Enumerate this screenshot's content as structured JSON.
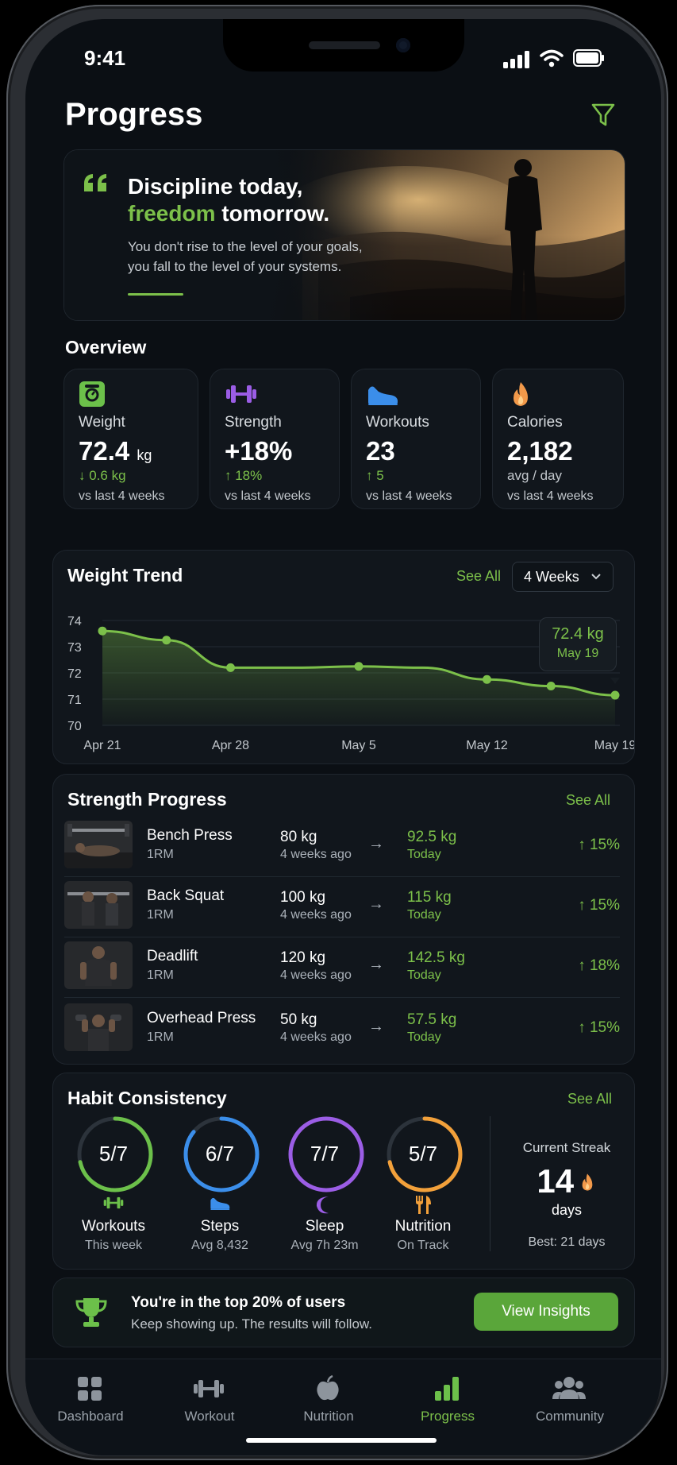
{
  "status": {
    "time": "9:41"
  },
  "header": {
    "title": "Progress",
    "filter_icon": "filter-icon"
  },
  "quote": {
    "line1": "Discipline today,",
    "line2_accent": "freedom",
    "line2_rest": " tomorrow.",
    "body1": "You don't rise to the level of your goals,",
    "body2": "you fall to the level of your systems.",
    "quote_icon": "quote-icon"
  },
  "overview": {
    "title": "Overview",
    "cards": [
      {
        "label": "Weight",
        "value": "72.4",
        "unit": "kg",
        "change": "↓ 0.6 kg",
        "vs": "vs last 4 weeks",
        "icon": "scale-icon",
        "color": "#6cc04a"
      },
      {
        "label": "Strength",
        "value": "+18%",
        "unit": "",
        "change": "↑ 18%",
        "vs": "vs last 4 weeks",
        "icon": "dumbbell-icon",
        "color": "#9b5de5"
      },
      {
        "label": "Workouts",
        "value": "23",
        "unit": "",
        "change": "↑ 5",
        "vs": "vs last 4 weeks",
        "icon": "shoe-icon",
        "color": "#3b8eea"
      },
      {
        "label": "Calories",
        "value": "2,182",
        "unit": "",
        "change": "avg / day",
        "vs": "vs last 4 weeks",
        "icon": "flame-icon",
        "color": "#f2994a"
      }
    ]
  },
  "weight_trend": {
    "title": "Weight Trend",
    "see_all": "See All",
    "range": "4 Weeks",
    "tooltip_value": "72.4 kg",
    "tooltip_date": "May 19"
  },
  "chart_data": {
    "type": "area",
    "x": [
      "Apr 21",
      "Apr 25",
      "Apr 28",
      "May 2",
      "May 5",
      "May 9",
      "May 12",
      "May 15",
      "May 19"
    ],
    "values": [
      73.6,
      73.25,
      72.2,
      72.2,
      72.25,
      72.2,
      71.75,
      71.5,
      71.15
    ],
    "point_markers": [
      0,
      1,
      2,
      4,
      6,
      7,
      8
    ],
    "xticks": [
      "Apr 21",
      "Apr 28",
      "May 5",
      "May 12",
      "May 19"
    ],
    "yticks": [
      "74",
      "73",
      "72",
      "71",
      "70"
    ],
    "ylim": [
      70,
      74
    ],
    "grid": true,
    "color": "#7cc04a"
  },
  "strength": {
    "title": "Strength Progress",
    "see_all": "See All",
    "rows": [
      {
        "name": "Bench Press",
        "sub": "1RM",
        "old": "80 kg",
        "old_sub": "4 weeks ago",
        "new": "92.5 kg",
        "new_sub": "Today",
        "pct": "↑ 15%"
      },
      {
        "name": "Back Squat",
        "sub": "1RM",
        "old": "100 kg",
        "old_sub": "4 weeks ago",
        "new": "115 kg",
        "new_sub": "Today",
        "pct": "↑ 15%"
      },
      {
        "name": "Deadlift",
        "sub": "1RM",
        "old": "120 kg",
        "old_sub": "4 weeks ago",
        "new": "142.5 kg",
        "new_sub": "Today",
        "pct": "↑ 18%"
      },
      {
        "name": "Overhead Press",
        "sub": "1RM",
        "old": "50 kg",
        "old_sub": "4 weeks ago",
        "new": "57.5 kg",
        "new_sub": "Today",
        "pct": "↑ 15%"
      }
    ]
  },
  "habits": {
    "title": "Habit Consistency",
    "see_all": "See All",
    "rings": [
      {
        "value": "5/7",
        "fraction": 0.714,
        "name": "Workouts",
        "sub": "This week",
        "color": "#6cc04a",
        "icon": "dumbbell-icon"
      },
      {
        "value": "6/7",
        "fraction": 0.857,
        "name": "Steps",
        "sub": "Avg 8,432",
        "color": "#3b8eea",
        "icon": "shoe-icon"
      },
      {
        "value": "7/7",
        "fraction": 1.0,
        "name": "Sleep",
        "sub": "Avg 7h 23m",
        "color": "#9b5de5",
        "icon": "moon-icon"
      },
      {
        "value": "5/7",
        "fraction": 0.714,
        "name": "Nutrition",
        "sub": "On Track",
        "color": "#f2a03a",
        "icon": "utensils-icon"
      }
    ],
    "streak_label": "Current Streak",
    "streak_value": "14",
    "streak_unit": "days",
    "best": "Best: 21 days"
  },
  "banner": {
    "title": "You're in the top 20% of users",
    "sub": "Keep showing up. The results will follow.",
    "button": "View Insights",
    "icon": "trophy-icon"
  },
  "nav": [
    {
      "label": "Dashboard",
      "icon": "dashboard-icon",
      "active": false
    },
    {
      "label": "Workout",
      "icon": "dumbbell-icon",
      "active": false
    },
    {
      "label": "Nutrition",
      "icon": "apple-icon",
      "active": false
    },
    {
      "label": "Progress",
      "icon": "bar-chart-icon",
      "active": true
    },
    {
      "label": "Community",
      "icon": "people-icon",
      "active": false
    }
  ]
}
